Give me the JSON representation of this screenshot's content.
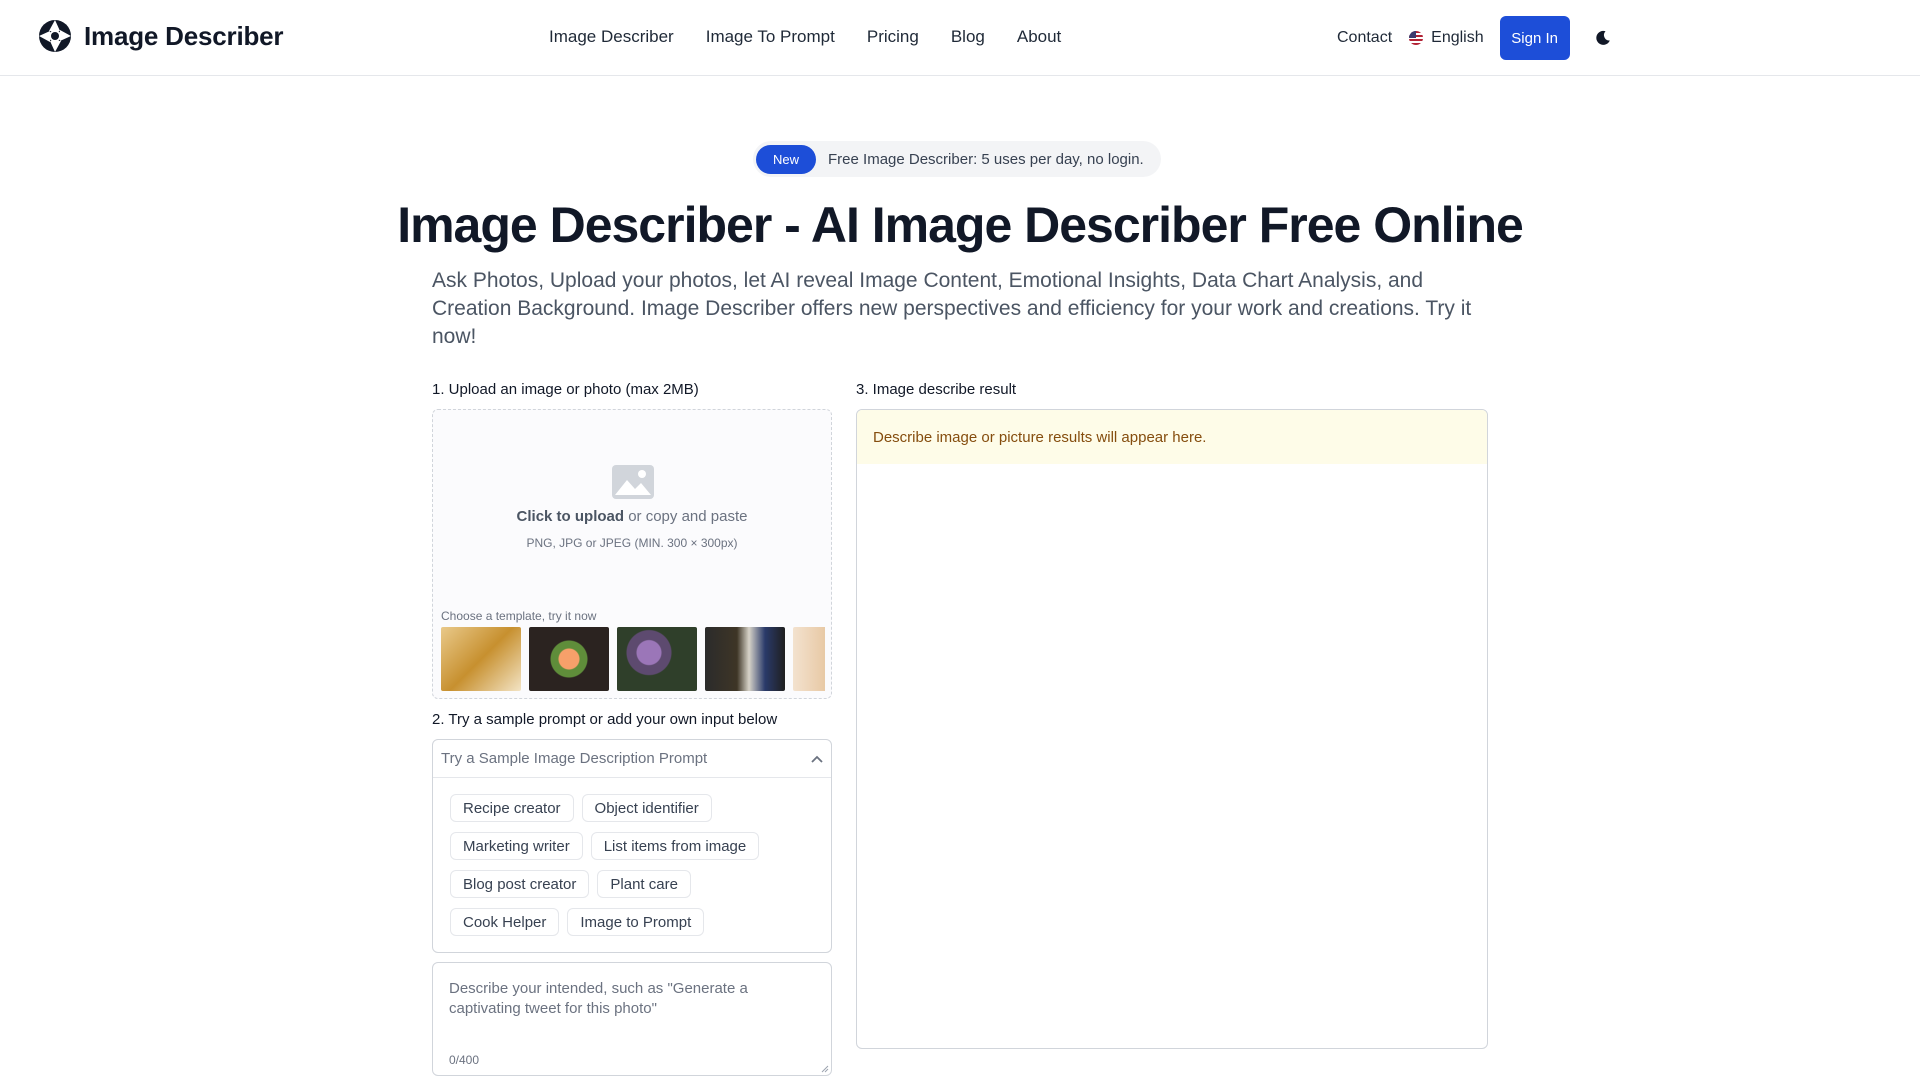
{
  "brand": {
    "name": "Image Describer",
    "logo_icon": "aperture-logo-icon"
  },
  "nav": {
    "items": [
      {
        "label": "Image Describer"
      },
      {
        "label": "Image To Prompt"
      },
      {
        "label": "Pricing"
      },
      {
        "label": "Blog"
      },
      {
        "label": "About"
      }
    ]
  },
  "header_right": {
    "contact": "Contact",
    "language": "English",
    "language_icon": "us-flag-icon",
    "sign_in": "Sign In",
    "theme_icon": "moon-icon"
  },
  "badge": {
    "tag": "New",
    "text": "Free Image Describer: 5 uses per day, no login."
  },
  "hero": {
    "title": "Image Describer - AI Image Describer Free Online",
    "subtitle": "Ask Photos, Upload your photos, let AI reveal Image Content, Emotional Insights, Data Chart Analysis, and Creation Background. Image Describer offers new perspectives and efficiency for your work and creations. Try it now!"
  },
  "upload": {
    "label": "1. Upload an image or photo (max 2MB)",
    "click_text": "Click to upload",
    "or_text": " or copy and paste",
    "formats": "PNG, JPG or JPEG (MIN. 300 × 300px)",
    "template_label": "Choose a template, try it now",
    "templates": [
      "template-1",
      "template-2",
      "template-3",
      "template-4",
      "template-5"
    ]
  },
  "prompt": {
    "label": "2. Try a sample prompt or add your own input below",
    "select_placeholder": "Try a Sample Image Description Prompt",
    "chips": [
      [
        "Recipe creator",
        "Object identifier"
      ],
      [
        "Marketing writer",
        "List items from image"
      ],
      [
        "Blog post creator",
        "Plant care"
      ],
      [
        "Cook Helper",
        "Image to Prompt"
      ]
    ],
    "textarea_placeholder": "Describe your intended, such as \"Generate a captivating tweet for this photo\"",
    "counter": "0/400"
  },
  "result": {
    "label": "3. Image describe result",
    "placeholder": "Describe image or picture results will appear here."
  },
  "colors": {
    "accent": "#1d4ed8",
    "result_bg": "#fefce8",
    "result_text": "#854d0e"
  }
}
